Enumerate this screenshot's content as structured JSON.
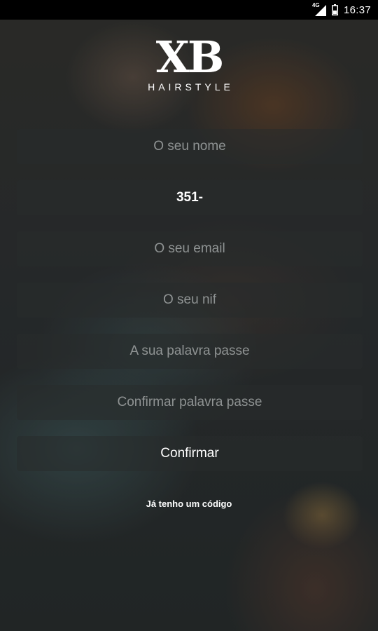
{
  "status_bar": {
    "network_type": "4G",
    "time": "16:37",
    "icons": [
      "signal-icon",
      "battery-icon"
    ]
  },
  "logo": {
    "mark": "XB",
    "subtitle": "HAIRSTYLE"
  },
  "form": {
    "name": {
      "placeholder": "O seu nome",
      "value": ""
    },
    "phone": {
      "placeholder": "",
      "value": "351-"
    },
    "email": {
      "placeholder": "O seu email",
      "value": ""
    },
    "nif": {
      "placeholder": "O seu nif",
      "value": ""
    },
    "password": {
      "placeholder": "A sua palavra passe",
      "value": ""
    },
    "confirm_password": {
      "placeholder": "Confirmar palavra passe",
      "value": ""
    },
    "confirm_label": "Confirmar",
    "code_link": "Já tenho um código"
  },
  "colors": {
    "field_background": "rgba(40,44,44,0.55)",
    "placeholder_text": "#8f9393",
    "text": "#ffffff"
  }
}
